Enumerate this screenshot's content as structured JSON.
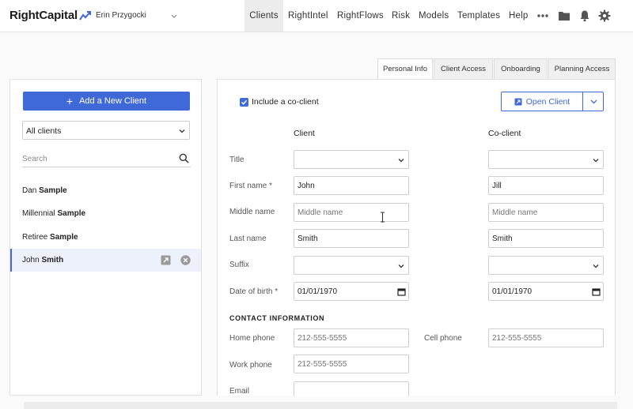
{
  "brand": {
    "logo_text": "RightCapital"
  },
  "user": {
    "name": "Erin Przygocki"
  },
  "nav": {
    "items": [
      "Clients",
      "RightIntel",
      "RightFlows",
      "Risk",
      "Models",
      "Templates",
      "Help"
    ],
    "active": "Clients",
    "icons": [
      "more-icon",
      "folder-icon",
      "bell-icon",
      "gear-icon"
    ]
  },
  "tabs": [
    "Personal Info",
    "Client Access",
    "Onboarding",
    "Planning Access"
  ],
  "active_tab": "Personal Info",
  "sidebar": {
    "add_button": "Add a New Client",
    "filter_value": "All clients",
    "search_placeholder": "Search",
    "clients": [
      {
        "first": "Dan",
        "last": "Sample"
      },
      {
        "first": "Millennial",
        "last": "Sample"
      },
      {
        "first": "Retiree",
        "last": "Sample"
      },
      {
        "first": "John",
        "last": "Smith",
        "selected": true
      }
    ]
  },
  "form": {
    "include_cocLient_label": "Include a co-client",
    "open_client_button": "Open Client",
    "client_header": "Client",
    "cocLient_header": "Co-client",
    "labels": {
      "title": "Title",
      "first_name": "First name *",
      "middle_name": "Middle name",
      "last_name": "Last name",
      "suffix": "Suffix",
      "dob": "Date of birth *"
    },
    "client": {
      "title": "",
      "first_name": "John",
      "middle_name": "",
      "middle_placeholder": "Middle name",
      "last_name": "Smith",
      "suffix": "",
      "dob": "01/01/1970"
    },
    "cocLient": {
      "title": "",
      "first_name": "Jill",
      "middle_name": "",
      "middle_placeholder": "Middle name",
      "last_name": "Smith",
      "suffix": "",
      "dob": "01/01/1970"
    },
    "contact_section": "CONTACT INFORMATION",
    "contact": {
      "home_phone_label": "Home phone",
      "home_phone_placeholder": "212-555-5555",
      "cell_phone_label": "Cell phone",
      "cell_phone_placeholder": "212-555-5555",
      "work_phone_label": "Work phone",
      "work_phone_placeholder": "212-555-5555",
      "email_label": "Email"
    }
  },
  "colors": {
    "accent": "#3f68d8",
    "selected_row": "#ecf1fb"
  }
}
